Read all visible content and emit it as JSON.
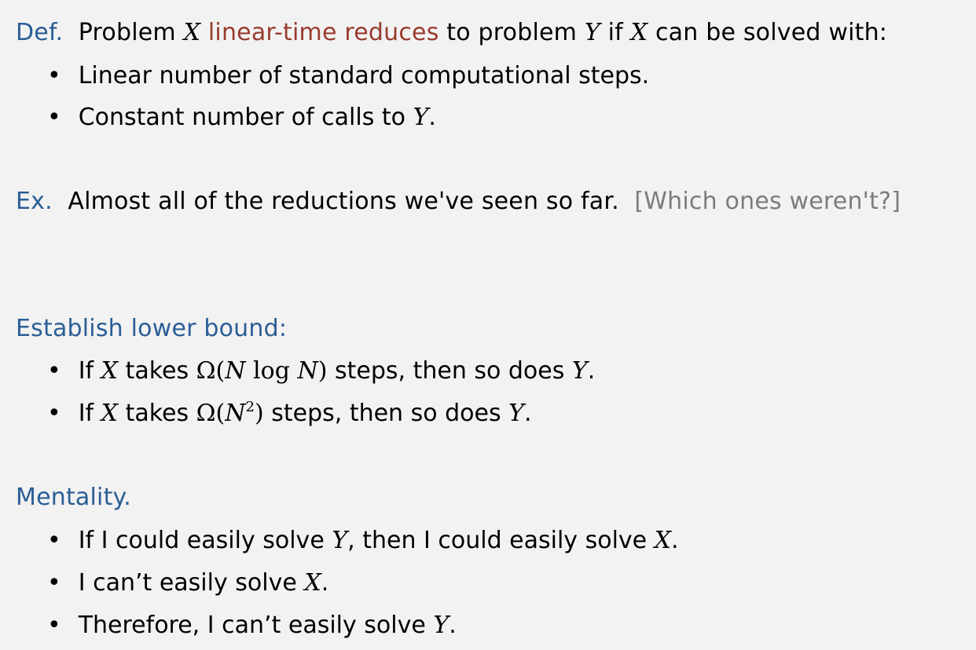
{
  "definition": {
    "label": "Def.",
    "text_1": "Problem",
    "var_x": "X",
    "highlight": "linear-time reduces",
    "text_2": "to problem",
    "var_y": "Y",
    "text_3": "if",
    "var_x2": "X",
    "text_4": "can be solved with:",
    "bullets": [
      {
        "text": "Linear number of standard computational steps."
      },
      {
        "text_a": "Constant number of calls to",
        "var": "Y",
        "text_b": "."
      }
    ]
  },
  "example": {
    "label": "Ex.",
    "text": "Almost all of the reductions we've seen so far.",
    "aside": "[Which ones weren't?]"
  },
  "lower_bound": {
    "heading": "Establish lower bound:",
    "bullets": [
      {
        "if": "If",
        "var_x": "X",
        "takes": "takes",
        "omega_open": "Ω(",
        "n1": "N",
        "log": "log",
        "n2": "N",
        "close": ")",
        "rest": "steps, then so does",
        "var_y": "Y",
        "end": "."
      },
      {
        "if": "If",
        "var_x": "X",
        "takes": "takes",
        "omega_open": "Ω(",
        "n": "N",
        "exp": "2",
        "close": ")",
        "rest": "steps, then so does",
        "var_y": "Y",
        "end": "."
      }
    ]
  },
  "mentality": {
    "heading": "Mentality.",
    "bullets": [
      {
        "a": "If I could easily solve",
        "v1": "Y",
        "b": ", then I could easily solve",
        "v2": "X",
        "c": "."
      },
      {
        "a": "I can’t easily solve",
        "v1": "X",
        "c": "."
      },
      {
        "a": "Therefore, I can’t easily solve",
        "v1": "Y",
        "c": "."
      }
    ]
  },
  "bullet_char": "•"
}
